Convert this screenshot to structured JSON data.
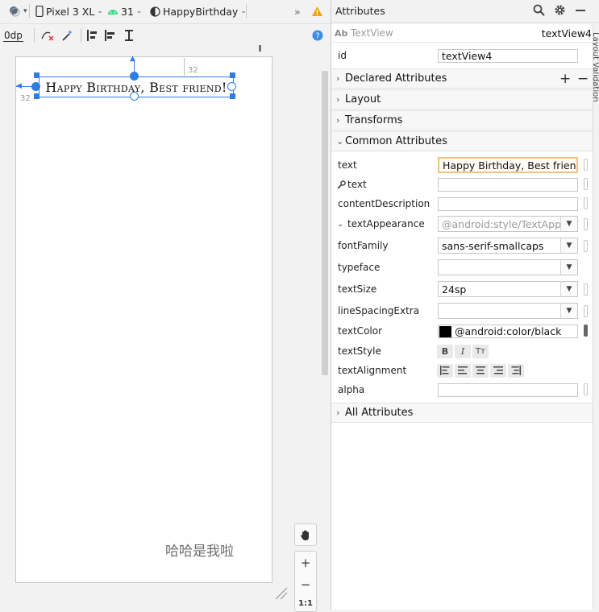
{
  "toolbar": {
    "device_name": "Pixel 3 XL",
    "api_level": "31",
    "theme_name": "HappyBirthday",
    "overflow": "»",
    "margin_value": "0dp"
  },
  "canvas": {
    "selected_text": "Happy Birthday, Best friend!",
    "margin_top_label": "32",
    "margin_left_label": "32",
    "bottom_text": "哈哈是我啦",
    "zoom_plus": "+",
    "zoom_minus": "−",
    "zoom_reset": "1:1"
  },
  "attributes": {
    "title": "Attributes",
    "widget_type": "TextView",
    "widget_type_badge": "Ab",
    "widget_id_display": "textView4",
    "id_label": "id",
    "id_value": "textView4",
    "sections": {
      "declared": "Declared Attributes",
      "layout": "Layout",
      "transforms": "Transforms",
      "common": "Common Attributes",
      "all": "All Attributes"
    },
    "declared_add": "+",
    "declared_remove": "−",
    "fields": {
      "text_label": "text",
      "text_value": "Happy Birthday, Best friend!",
      "tools_text_label": "text",
      "content_description_label": "contentDescription",
      "text_appearance_label": "textAppearance",
      "text_appearance_placeholder": "@android:style/TextApp",
      "font_family_label": "fontFamily",
      "font_family_value": "sans-serif-smallcaps",
      "typeface_label": "typeface",
      "text_size_label": "textSize",
      "text_size_value": "24sp",
      "line_spacing_label": "lineSpacingExtra",
      "text_color_label": "textColor",
      "text_color_value": "@android:color/black",
      "text_style_label": "textStyle",
      "text_alignment_label": "textAlignment",
      "alpha_label": "alpha"
    },
    "side_tab": "Layout Validation"
  },
  "colors": {
    "accent": "#2f7de1",
    "focus_border": "#f2c37a",
    "text_color_swatch": "#000000",
    "warning": "#f0a30a",
    "help": "#3a8ee6"
  }
}
